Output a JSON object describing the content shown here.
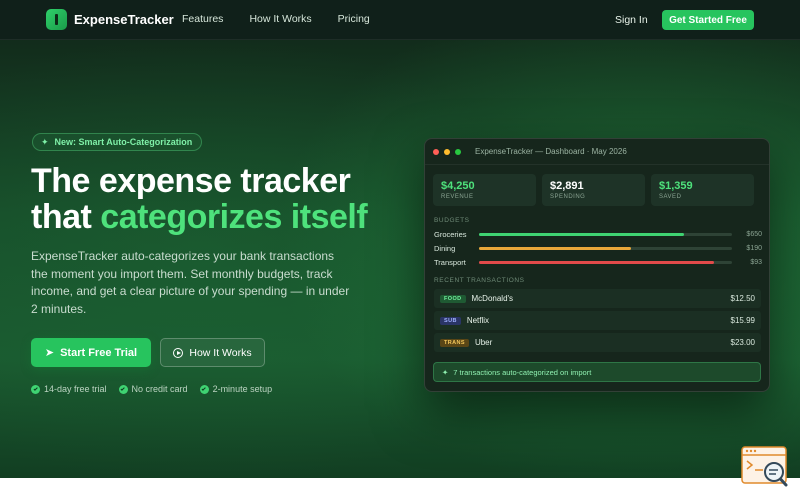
{
  "nav": {
    "brand": "ExpenseTracker",
    "links": [
      "Features",
      "How It Works",
      "Pricing"
    ],
    "signin": "Sign In",
    "cta": "Get Started Free"
  },
  "hero": {
    "badge": "New: Smart Auto-Categorization",
    "headline_line1": "The expense tracker",
    "headline_line2_plain": "that ",
    "headline_line2_accent": "categorizes itself",
    "subcopy": "ExpenseTracker auto-categorizes your bank transactions the moment you import them. Set monthly budgets, track income, and get a clear picture of your spending — in under 2 minutes.",
    "primary_button": "Start Free Trial",
    "secondary_button": "How It Works",
    "perks": [
      "14-day free trial",
      "No credit card",
      "2-minute setup"
    ]
  },
  "dashboard": {
    "window_title": "ExpenseTracker — Dashboard · May 2026",
    "stats": [
      {
        "value": "$4,250",
        "label": "REVENUE",
        "color": "#4ee27c"
      },
      {
        "value": "$2,891",
        "label": "SPENDING",
        "color": "#ffffff"
      },
      {
        "value": "$1,359",
        "label": "SAVED",
        "color": "#4ee27c"
      }
    ],
    "budgets_label": "BUDGETS",
    "budgets": [
      {
        "name": "Groceries",
        "amount": "$650",
        "progress": 0.81,
        "color": "#3fd372"
      },
      {
        "name": "Dining",
        "amount": "$190",
        "progress": 0.6,
        "color": "#e8a73a"
      },
      {
        "name": "Transport",
        "amount": "$93",
        "progress": 0.93,
        "color": "#e24a4a"
      }
    ],
    "transactions_label": "RECENT TRANSACTIONS",
    "transactions": [
      {
        "tag": "FOOD",
        "name": "McDonald's",
        "amount": "$12.50",
        "tag_bg": "#1f5a33",
        "tag_fg": "#6ff09c"
      },
      {
        "tag": "SUB",
        "name": "Netflix",
        "amount": "$15.99",
        "tag_bg": "#2a3566",
        "tag_fg": "#9fb0ff"
      },
      {
        "tag": "TRANS",
        "name": "Uber",
        "amount": "$23.00",
        "tag_bg": "#5a4616",
        "tag_fg": "#f3c65a"
      }
    ],
    "auto_note": "7 transactions auto-categorized on import"
  }
}
